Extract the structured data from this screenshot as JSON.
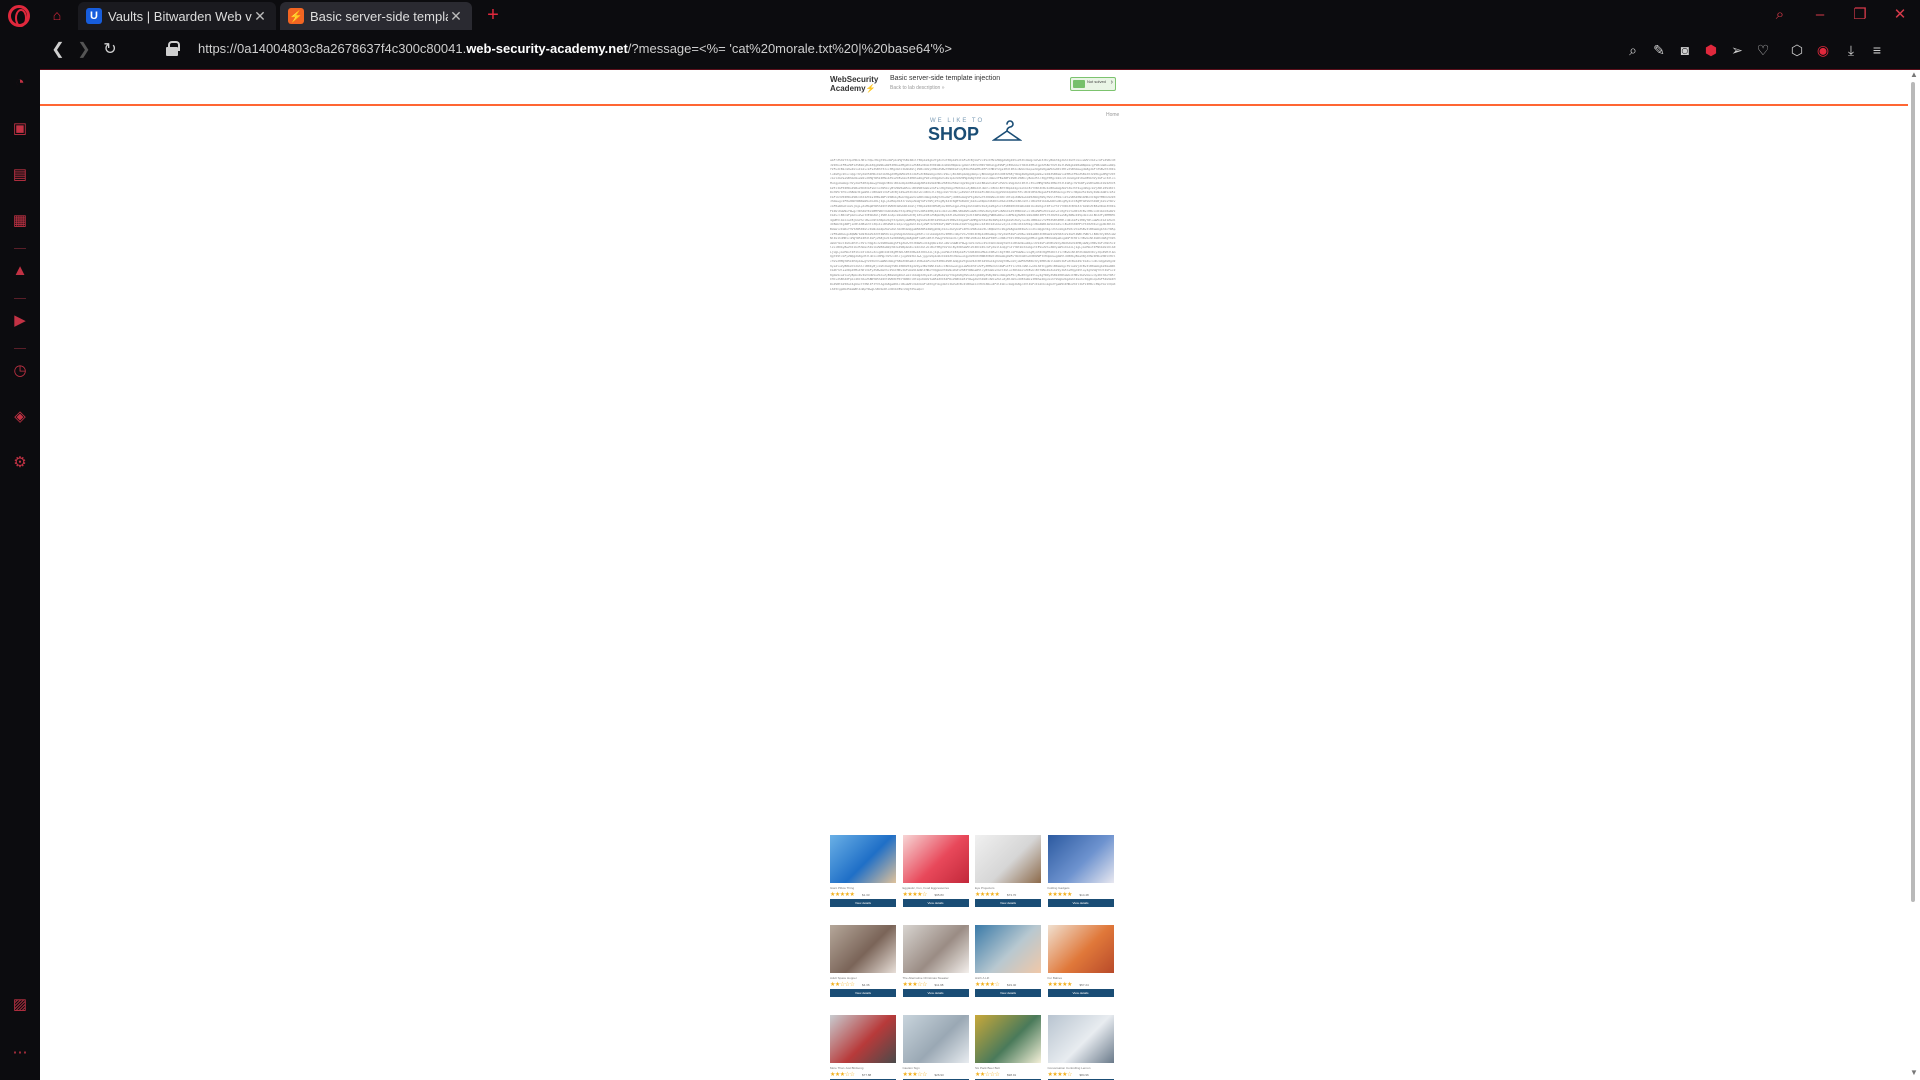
{
  "tabs": [
    {
      "title": "Vaults | Bitwarden Web vau",
      "favicon": "U"
    },
    {
      "title": "Basic server-side template",
      "favicon": "⚡"
    }
  ],
  "url": {
    "prefix": "https://0a14004803c8a2678637f4c300c80041.",
    "domain": "web-security-academy.net",
    "suffix": "/?message=<%= 'cat%20morale.txt%20|%20base64'%>"
  },
  "lab": {
    "logo_line1": "WebSecurity",
    "logo_line2": "Academy",
    "title": "Basic server-side template injection",
    "subtitle": "Back to lab description »",
    "status": "Not solved"
  },
  "home_link": "Home",
  "shop": {
    "tagline": "WE LIKE TO",
    "name": "SHOP"
  },
  "encoded_output": "aGFrZS9zY3JpcHRzL3Rlc3QucHkgY29udGFpbnMgYSBzZWxlY3Rpb24gb2YgZnVuY3Rpb25zIGFuZCBjbGFzc2VzIHVzZWQgdG8gZ2VuZXJhdGUgcmVwb3J0cyBmb3IgdGhlIGVtcGxveWVlIG1vcmFsZSBzdXJ2ZXkuIFBsZWFzZSBkbyBub3QgbW9kaWZ5IHRoaXMgZmlsZSB3aXRob3V0IGNvbnN1bHRpbmcgdGhlIEhSIHRlYW0uCgpEZWFyIENvbGxlYWd1ZXMsCgpXZSBoYXZlIGJlZW4gbm90aWNpbmcgYSBzaWduaWZpY2FudCBkcm9wIGluIG1vcmFsZSBhY3Jvc3MgdGhlIG9mZmljZSBvdmVyIHRoZSBwYXN0IGZldyBtb250aHMuIEFzIHN1Y2gsIHdlIHdvdWxkIGxpa2UgdG8gaW52aXRlIHlvdSBhbGwgdG8gdGFrZSBwYXJ0IGluIGEgc2hvcnQgc3VydmV5IHRvIGhlbHAgdXMgdW5kZXJzdGFuZCB0aGUgcmVhc29ucyBiZWhpbmQgdGhpcyBhbmQgd2hhdCB3ZSBjYW4gZG8gdG8gaW1wcm92ZSB0aGluZ3MuIFRoZSBzdXJ2ZXkgaXMgY29tcGxldGVseSBhbm9ueW1vdXMgYW5kIHNob3VsZCBvbmx5IHRha2UgYWJvdXQgdGVuIG1pbnV0ZXMgdG8gY29tcGxldGUuIFBsZWFzZSBiZSBhcyBob25lc3QgYXMgcG9zc2libGUgd2l0aCB5b3VyIGFuc3dlcnMuCgpUaGUgc3VydmV5IHdpbGwgYmUgb3BlbiB1bnRpbCB0aGUgZW5kIG9mIHRoZSBtb250aC4gV2Ugd2lsbCB0aGVuIGFuYWx5c2UgdGhlIHJlc3VsdHMgYW5kIHNoYXJlIGEgc3VtbWFyeSB3aXRoIGV2ZXJ5b25lIGF0IHRoZSBuZXh0IGFsbC1oYW5kcyBtZWV0aW5nLiBXZSB3aWxsIGFsc28gYmUgcHV0dGluZyB0b2dldGhlciBhbiBhY3Rpb24gcGxhbiBiYXNlZCBvbiB0aGUgZmVlZGJhY2sgd2UgcmVjZWl2ZS4KClRoYW5rIHlvdSBmb3IgeW91ciB0aW1lIGFuZCBjb29wZXJhdGlvbi4KCkJlc3QgcmVnYXJkcywKVGhlIE1hbmFnZW1lbnQgVGVhbQoKUC5TLiBJZiB5b3UgaGF2ZSBhbnkgcXVlc3Rpb25zIG9yIGNvbmNlcm5zIGFib3V0IHRoZSBzdXJ2ZXksIHBsZWFzZSBkbyBub3QgaGVzaXRhdGUgdG8gY29udGFjdCB0aGUgSFIgZGVwYXJ0bWVudC4KCi0tLQoKRW1wbG95ZWUgTW9yYWxlIFN1cnZleSBSZXN1bHRzIC0gUTMKCk92ZXJhbGwgc2F0aXNmYWN0aW9uOiA0LjIgLyAxMApXb3JrLWxpZmUgYmFsYW5jZTogMy44IC8gMTAKUmVjb2duaXRpb246IDIuOSAvIDEwCkNhcmVlciBkZXZlbG9wbWVudDogMy4xIC8gMTAKVGVhbSBjb2xsYWJvcmF0aW9uOiA2LjUgLyAxMApNYW5hZ2VtZW50IGNvbW11bmljYXRpb246IDMuMyAvIDEwCgpLZXkgdGhlbWVzIGZyb20gZnJlZSB0ZXh0IGNvbW1lbnRzOgotIEluY3JlYXNlZCB3b3JrbG9hZCB3aXRob3V0IGFkZGl0aW9uYWwgc3RhZmYKLSBMYWNrIG9mIGNsYXJpdHkgYXJvdW5kIHByb21vdGlvbnMKLSBGZWVsaW5nIHVuZGVydmFsdWVkIGJ5IHNlbmlvciBsZWFkZXJzaGlwCi0gTGltaXRlZCBvcHBvcnR1bml0aWVzIGZvciB0cmFpbmluZwotIE9mZmljZSBlbnZpcm9ubWVudCBjb3VsZCBiZSBpbXByb3ZlZAoKUmVjb21tZW5kZWQgYWN0aW9uczoKMS4gSW50cm9kdWNlIHF1YXJ0ZXJseSByZWNvZ25pdGlvbiBhd2FyZHMKMi4gUHVibGlzaCBjbGVhciBwcm9tb3Rpb24gY3JpdGVyaWEKMy4gSG9sZCBtb250aGx5IHRvd24gaGFsbHMgd2l0aCBzZW5pb3IgbGVhZGVycwo0LiBBbGxvY2F0ZSBhIHBlcnNvbmFsIHRyYWluaW5nIGJ1ZGdldCBmb3IgZWFjaCBlbXBsb3llZQo1LiBSZWZ1cmJpc2ggdGhlIGJyZWFrb3V0IGFyZWFzIG9uIGVhY2ggZmxvb3IKCkZvbGxvdy11cCBzdXJ2ZXkgc2NoZWR1bGVkIGZvciBuZXh0IHF1YXJ0ZXIuCgpOb3RlOiBUaGlzIGRvY3VtZW50IGlzIGNvbmZpZGVudGlhbCBhbmQgaW50ZW5kZWQgZm9yIGludGVybmFsIHVzZSBvbmx5LiBQbGVhc2UgZG8gbm90IGZvcndhcmQgb3Igc2hhcmUgb3V0c2lkZSBvZiB0aGUgb3JnYW5pc2F0aW9uLgoKQWNrbm93bGVkZ2VtZW50czogV2UgdGhhbmsgZXZlcnlvbmUgd2hvIHBhcnRpY2lwYXRlZCBpbiB0aGUgc3VydmV5IGFuZCBwcm92aWRlZCB0aG91Z2h0ZnVsIGZlZWRiYWNrLiBZb3VyIHZvaWNlIG1hdHRlcnMgYW5kIHdlIGFyZSBjb21taXR0ZWQgdG8gbWFraW5nIHJlYWwgY2hhbmdlcyBiYXNlZCBvbiB3aGF0IHlvdSBoYXZlIHRvbGQgdXMuCgpBcHBlbmRpeDogUmF3IHJlc3BvbnNlIGRhdGEgYXZhaWxhYmxlIG9uIHJlcXVlc3QgZnJvbSB0aGUgSFIgZGVwYXJ0bWVudC4gQWxsIGluZGl2aWR1YWwgcmVzcG9uc2VzIGhhdmUgYmVlbiBhbm9ueW1pc2VkIGFuZCBhZ2dyZWdhdGVkIHByaW9yIHRvIGFuYWx5c2lzLiBObyBwZXJzb25hbGx5IGlkZW50aWZpYWJsZSBpbmZvcm1hdGlvbiBoYXMgYmVlbiByZXRhaW5lZC4KCkRlcGFydG1lbnQgYnJlYWtkb3duOgotIEVuZ2luZWVyaW5nOiAzLjkgLyAxMAotIFNhbGVzOiA0LjUgLyAxMAotIE1hcmtldGluZzogNC44IC8gMTAKLSBTdXBwb3J0OiAzLjIgLyAxMAotIEZpbmFuY2U6IDUuMSAvIDEwCi0gT3BlcmF0aW9uczogMy43IC8gMTAKClJlc3BvbnNlIHJhdGU6IDcyJQoKVHJlbmQgY29tcGFyZWQgdG8gcHJldmlvdXMgcXVhcnRlcjogZG93biAwLjggcG9pbnRzIG92ZXJhbGwuCgpOZXh0IHN0ZXBzOiBUaGUgbWFuYWdlbWVudCB0ZWFtIHdpbGwgbWVldCB0byBkaXNjdXNzIHRoZXNlIHJlc3VsdHMgYW5kIHdpbGwgY29tbXVuaWNhdGUgYSBkZXRhaWxlZCBwbGFuIGJ5IHRoZSBlbmQgb2YgbmV4dCBtb250aC4gV2UgYXBwcmVjaWF0ZSB5b3VyIHBhdGllbmNlIGFuZCBsb29rIGZvcndhcmQgdG8gd29ya2luZyB0b2dldGhlciB0byBjcmVhdGUgYSBiZXR0ZXIgd29ya3BsYWNlIGZvciBhbGwuCgpLaW5kIHJlZ2FyZHMsCkh1bWFuIFJlc291cmNlcwoKLS0tCgpPbiB0aGUgc3ViamVjdCBvZiB0aGUgb2ZmaWNlIGZhY2lsaXRpZXMsIHdlIGFyZSBwbGVhc2VkIHRvIGFubm91bmNlIHRoYXQgbmV3IGNvZmZlZSBtYWNoaW5lcyB3aWxsIGJlIGluc3RhbGxlZCBvbiBlYWNoIGZsb29yIG5leHQgd2Vlay4gV2UgYXJlIGFsc28gbG9va2luZyBpbnRvIGV4dGVuZGluZyB0aGUgZmxleGlibGUgd29ya2luZyBwb2xpY3kgdG8gYWxsb3cgbW9yZSByZW1vdGUgZGF5cyBwZXIgd2Vlay4gTW9yZSBkZXRhaWxzIHRvIGZvbGxvdy4KClRoYW5rIHlvdSBhZ2Fpbi4KClRoZSBNYW5hZ2VtZW50IFRlYW0KCi0tLQoKUmVtaW5kZXI6IFRoZSBhbm51YWwgdGVhbSBidWlsZGluZyBldmVudCB3aWxsIHRha2UgcGxhY2Ugb24gdGhlIGxhc3QgRnJpZGF5IG9mIHRoZSBtb250aC4gUGxlYXNlIFJTVlAgdG8geW91ciBsaW5lIG1hbmFnZXIgYnkgdGhlIGVuZCBvZiB0aGlzIHdlZWsuIFdlIGhvcGUgdG8gc2VlIGFzIG1hbnkgb2YgeW91IHRoZXJlIGFzIHBvc3NpYmxlIQoKLS0tCgpDb25maWRlbnRpYWwgLSBJbnRlcm5hbCBVc2UgT25seQo=",
  "products": [
    {
      "name": "Giant Pillow Thing",
      "price": "$1.33",
      "stars": 5,
      "button": "View details",
      "img": [
        "#6ab0e6",
        "#1f6fc7",
        "#e0c29a"
      ]
    },
    {
      "name": "Eggtastic, Fun, Food Eggcessories",
      "price": "$95.83",
      "stars": 4,
      "button": "View details",
      "img": [
        "#f7d6d6",
        "#e8485a",
        "#c2283a"
      ]
    },
    {
      "name": "Eye Projectors",
      "price": "$73.70",
      "stars": 5,
      "button": "View details",
      "img": [
        "#f0f0f0",
        "#d6d6d6",
        "#8c6a4a"
      ]
    },
    {
      "name": "Folding Gadgets",
      "price": "$14.48",
      "stars": 5,
      "button": "View details",
      "img": [
        "#2c5aa0",
        "#6e93cf",
        "#e8e8f0"
      ]
    },
    {
      "name": "Adult Space Hopper",
      "price": "$4.36",
      "stars": 2,
      "button": "View details",
      "img": [
        "#b5a79a",
        "#7a6458",
        "#e8dfd8"
      ]
    },
    {
      "name": "The Alternative Christmas Sweater",
      "price": "$11.98",
      "stars": 3,
      "button": "View details",
      "img": [
        "#d8d4d0",
        "#9a8c84",
        "#f4f0ec"
      ]
    },
    {
      "name": "Hitch A Lift",
      "price": "$19.40",
      "stars": 4,
      "button": "View details",
      "img": [
        "#3a7aa8",
        "#b8c8d0",
        "#f0c8a8"
      ]
    },
    {
      "name": "Fur Babies",
      "price": "$57.24",
      "stars": 5,
      "button": "View details",
      "img": [
        "#f0e0d0",
        "#e0783a",
        "#b84a2a"
      ]
    },
    {
      "name": "More Than Just Birdsong",
      "price": "$77.88",
      "stars": 3,
      "button": "View details",
      "img": [
        "#c8ccd0",
        "#b83a3a",
        "#4a4a4a"
      ]
    },
    {
      "name": "Caution Sign",
      "price": "$26.93",
      "stars": 3,
      "button": "View details",
      "img": [
        "#c8d4dc",
        "#9aa8b4",
        "#e8ecf0"
      ]
    },
    {
      "name": "Six Pack Beer Belt",
      "price": "$98.91",
      "stars": 2,
      "button": "View details",
      "img": [
        "#c8a83a",
        "#4a7a5a",
        "#f4f0d8"
      ]
    },
    {
      "name": "Conversation Controlling Lemon",
      "price": "$84.96",
      "stars": 4,
      "button": "View details",
      "img": [
        "#b8c4d0",
        "#e8ecf0",
        "#6a7a8a"
      ]
    }
  ],
  "colors": {
    "accent": "#e0283c",
    "lab_orange": "#ff6633",
    "shop_blue": "#1a4d75"
  }
}
